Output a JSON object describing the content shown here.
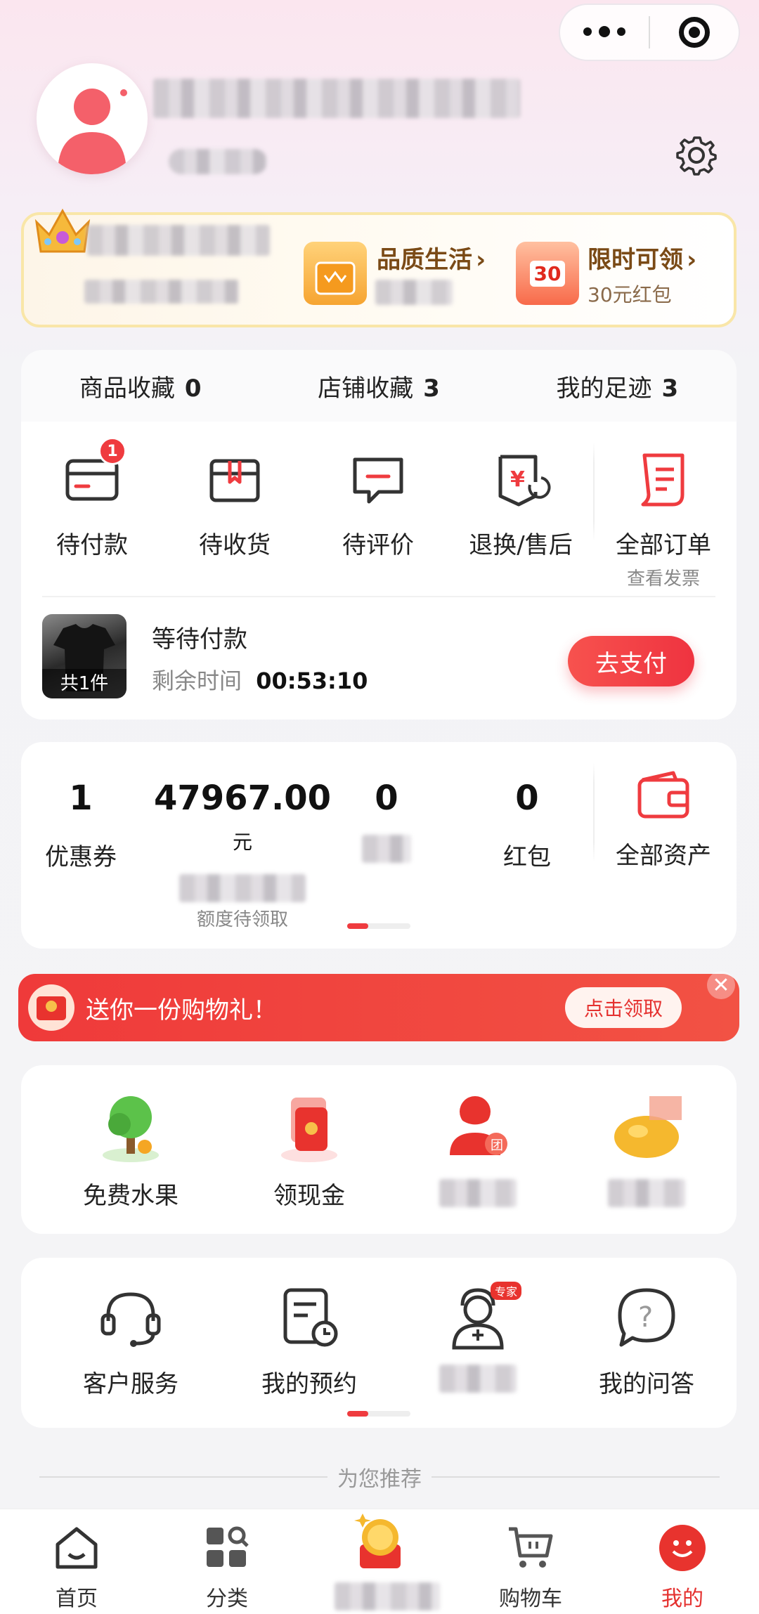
{
  "favorites": [
    {
      "label": "商品收藏",
      "count": "0"
    },
    {
      "label": "店铺收藏",
      "count": "3"
    },
    {
      "label": "我的足迹",
      "count": "3"
    }
  ],
  "vip": {
    "item1": {
      "title": "品质生活",
      "chev": "›"
    },
    "item2": {
      "title": "限时可领",
      "chev": "›",
      "sub": "30元红包",
      "icon_text": "30"
    }
  },
  "orders": {
    "tabs": [
      {
        "label": "待付款",
        "badge": "1",
        "icon": "wallet-card-icon"
      },
      {
        "label": "待收货",
        "icon": "package-icon"
      },
      {
        "label": "待评价",
        "icon": "comment-icon"
      },
      {
        "label": "退换/售后",
        "icon": "refund-icon"
      },
      {
        "label": "全部订单",
        "sub": "查看发票",
        "icon": "order-list-icon"
      }
    ],
    "pending": {
      "thumb_label": "共1件",
      "title": "等待付款",
      "remain_label": "剩余时间",
      "remain_time": "00:53:10",
      "pay_button": "去支付"
    }
  },
  "assets": {
    "coupon": {
      "value": "1",
      "label": "优惠券"
    },
    "credit": {
      "value": "47967.00",
      "unit": "元",
      "sub": "额度待领取"
    },
    "third": {
      "value": "0"
    },
    "redpacket": {
      "value": "0",
      "label": "红包"
    },
    "all": {
      "label": "全部资产"
    }
  },
  "gift": {
    "text": "送你一份购物礼！",
    "button": "点击领取",
    "close": "✕"
  },
  "services": [
    {
      "label": "免费水果",
      "icon": "tree-icon"
    },
    {
      "label": "领现金",
      "icon": "red-envelope-icon"
    },
    {
      "label": "",
      "icon": "group-buy-icon"
    },
    {
      "label": "",
      "icon": "coin-icon"
    }
  ],
  "tools": [
    {
      "label": "客户服务",
      "icon": "headset-icon"
    },
    {
      "label": "我的预约",
      "icon": "appointment-icon"
    },
    {
      "label": "",
      "icon": "doctor-icon",
      "tag": "专家"
    },
    {
      "label": "我的问答",
      "icon": "question-icon"
    }
  ],
  "recommend": "为您推荐",
  "tabbar": [
    {
      "label": "首页",
      "icon": "home-icon"
    },
    {
      "label": "分类",
      "icon": "category-icon"
    },
    {
      "label": "",
      "icon": "coin-promo-icon"
    },
    {
      "label": "购物车",
      "icon": "cart-icon"
    },
    {
      "label": "我的",
      "icon": "profile-icon",
      "active": true
    }
  ],
  "colors": {
    "accent": "#ef3b3f",
    "vip_text": "#7a4a16",
    "gift_bar": "#ef3a3a"
  }
}
